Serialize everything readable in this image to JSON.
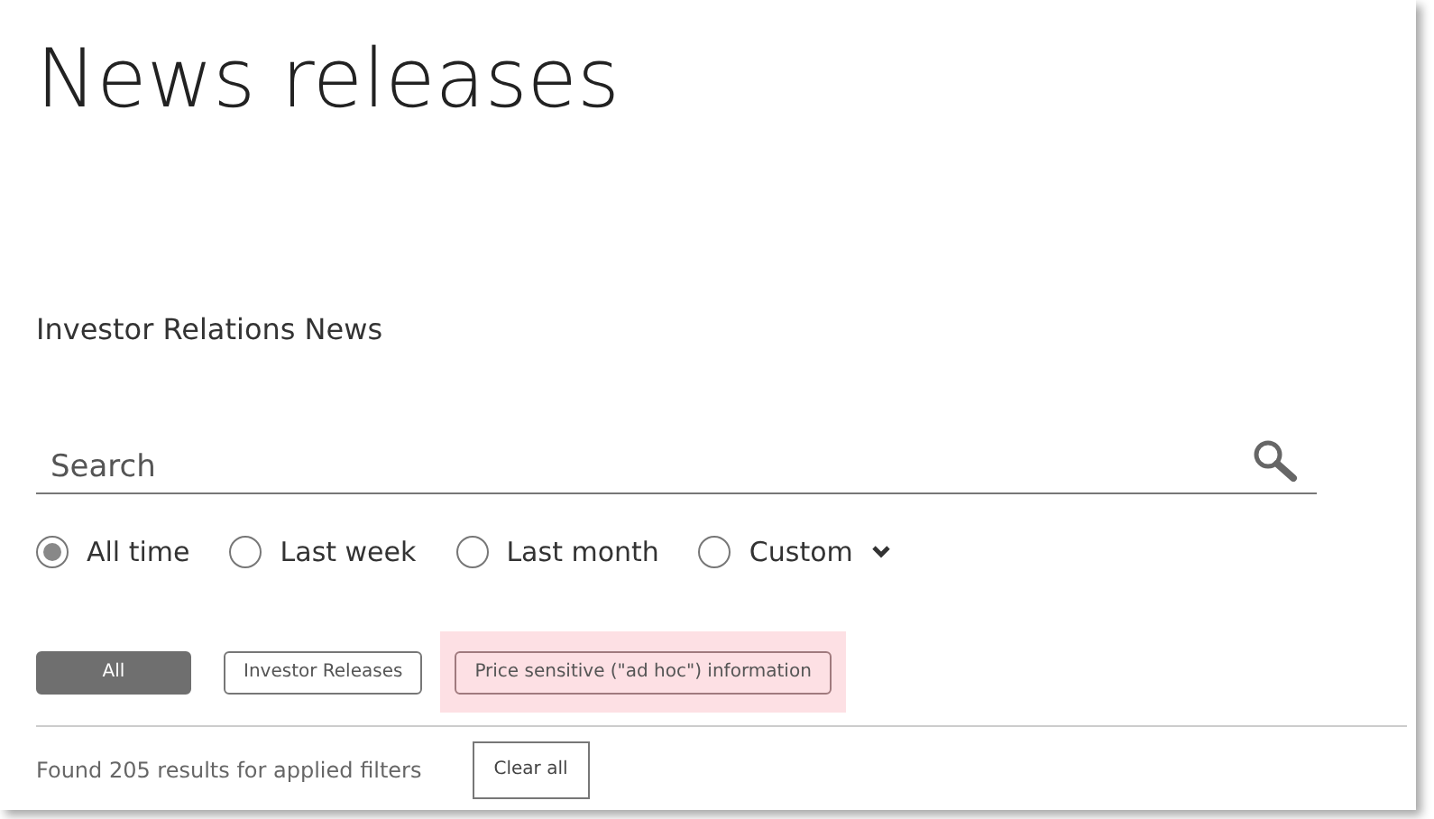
{
  "title": "News releases",
  "subtitle": "Investor Relations News",
  "search": {
    "placeholder": "Search"
  },
  "periods": [
    {
      "label": "All time",
      "selected": true,
      "dropdown": false
    },
    {
      "label": "Last week",
      "selected": false,
      "dropdown": false
    },
    {
      "label": "Last month",
      "selected": false,
      "dropdown": false
    },
    {
      "label": "Custom",
      "selected": false,
      "dropdown": true
    }
  ],
  "filters": [
    {
      "label": "All",
      "selected": true,
      "highlighted": false
    },
    {
      "label": "Investor Releases",
      "selected": false,
      "highlighted": false
    },
    {
      "label": "Price sensitive (\"ad hoc\") information",
      "selected": false,
      "highlighted": true
    }
  ],
  "results": {
    "text": "Found 205 results for applied filters",
    "clear_button": "Clear all"
  }
}
